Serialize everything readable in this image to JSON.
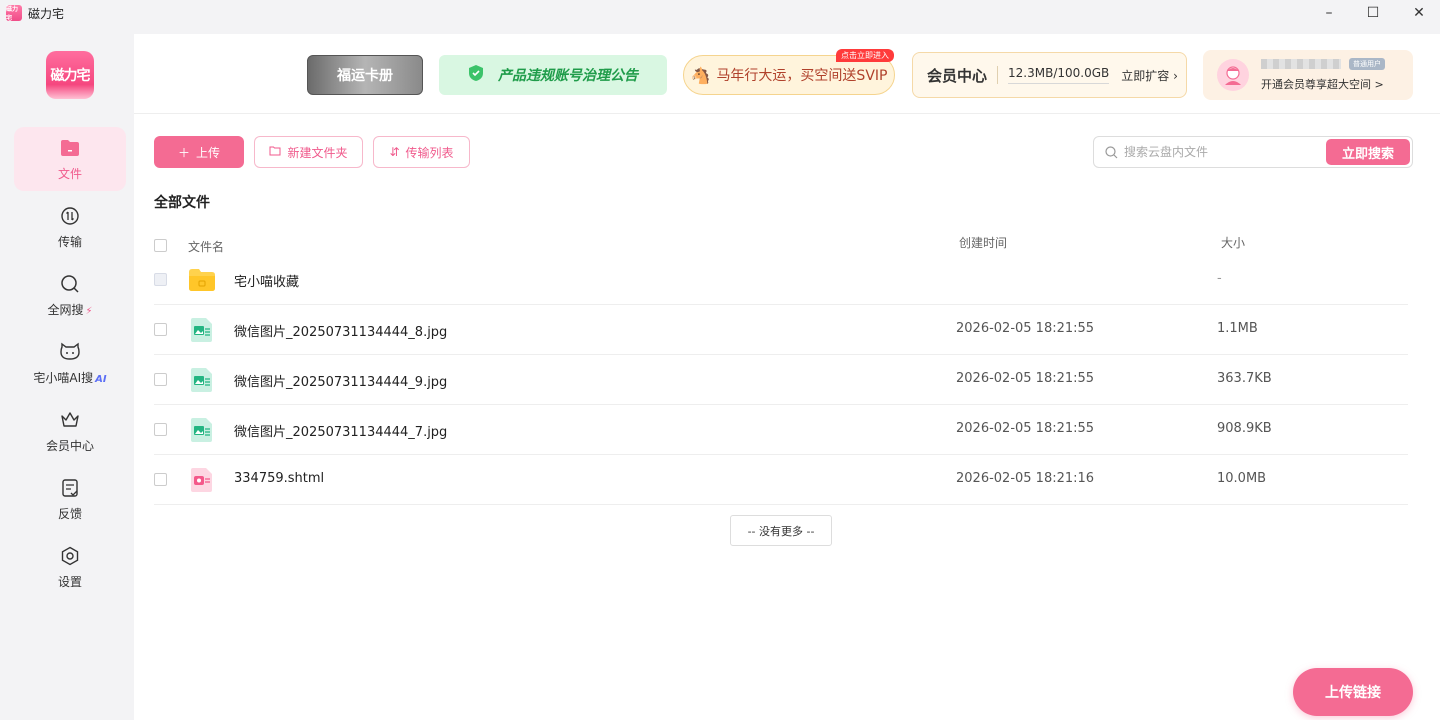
{
  "window": {
    "app_icon_text": "磁力宅",
    "title": "磁力宅",
    "minimize": "–",
    "maximize": "☐",
    "close": "✕"
  },
  "sidebar": {
    "logo_text": "磁力宅",
    "items": [
      {
        "label": "文件",
        "icon": "folder-icon",
        "active": true
      },
      {
        "label": "传输",
        "icon": "transfer-icon"
      },
      {
        "label": "全网搜",
        "icon": "search-icon",
        "badge": "⚡"
      },
      {
        "label": "宅小喵AI搜",
        "icon": "cat-icon",
        "badge": "AI"
      },
      {
        "label": "会员中心",
        "icon": "crown-icon"
      },
      {
        "label": "反馈",
        "icon": "feedback-icon"
      },
      {
        "label": "设置",
        "icon": "gear-icon"
      }
    ]
  },
  "banners": {
    "fuyun_title": "福运卡册",
    "notice": "产品违规账号治理公告",
    "promo_text": "马年行大运，买空间送SVIP",
    "promo_tag": "点击立即进入",
    "vip_title": "会员中心",
    "vip_usage": "12.3MB/100.0GB",
    "vip_expand": "立即扩容 ›",
    "user_tag": "普通用户",
    "user_sub": "开通会员尊享超大空间 >"
  },
  "toolbar": {
    "upload": "上传",
    "new_folder": "新建文件夹",
    "transfer_list": "传输列表",
    "search_placeholder": "搜索云盘内文件",
    "search_button": "立即搜索"
  },
  "section_title": "全部文件",
  "table": {
    "headers": {
      "name": "文件名",
      "created": "创建时间",
      "size": "大小"
    },
    "rows": [
      {
        "name": "宅小喵收藏",
        "created": "",
        "size": "-",
        "type": "folder"
      },
      {
        "name": "微信图片_20250731134444_8.jpg",
        "created": "2026-02-05 18:21:55",
        "size": "1.1MB",
        "type": "image"
      },
      {
        "name": "微信图片_20250731134444_9.jpg",
        "created": "2026-02-05 18:21:55",
        "size": "363.7KB",
        "type": "image"
      },
      {
        "name": "微信图片_20250731134444_7.jpg",
        "created": "2026-02-05 18:21:55",
        "size": "908.9KB",
        "type": "image"
      },
      {
        "name": "334759.shtml",
        "created": "2026-02-05 18:21:16",
        "size": "10.0MB",
        "type": "web"
      }
    ]
  },
  "no_more": "-- 没有更多 --",
  "upload_link": "上传链接",
  "colors": {
    "accent": "#f46b93",
    "active_bg": "#fde6ee",
    "notice_green": "#1f9c4a"
  }
}
